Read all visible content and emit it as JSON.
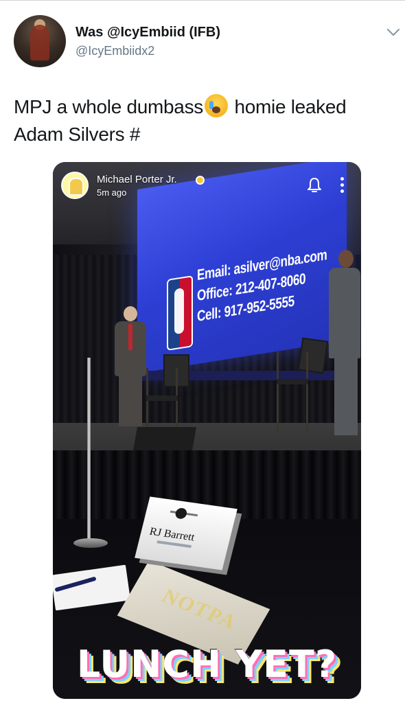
{
  "tweet": {
    "display_name": "Was @IcyEmbiid (IFB)",
    "handle": "@IcyEmbiidx2",
    "text_part1": "MPJ a whole dumbass",
    "text_part2": " homie leaked Adam Silvers #",
    "emoji": "crying-face-emoji",
    "menu_icon": "chevron-down-icon"
  },
  "snap": {
    "username": "Michael Porter Jr.",
    "time": "5m ago",
    "icons": [
      "bell-icon",
      "more-vertical-icon"
    ],
    "screen_lines": [
      "Email: asilver@nba.com",
      "Office: 212-407-8060",
      "Cell: 917-952-5555"
    ],
    "namecard": "RJ Barrett",
    "caption": "LUNCH YET?"
  },
  "colors": {
    "text": "#14171a",
    "secondary": "#657786",
    "screen_blue": "#2d3fd4",
    "snap_yellow": "#f7c62f"
  }
}
